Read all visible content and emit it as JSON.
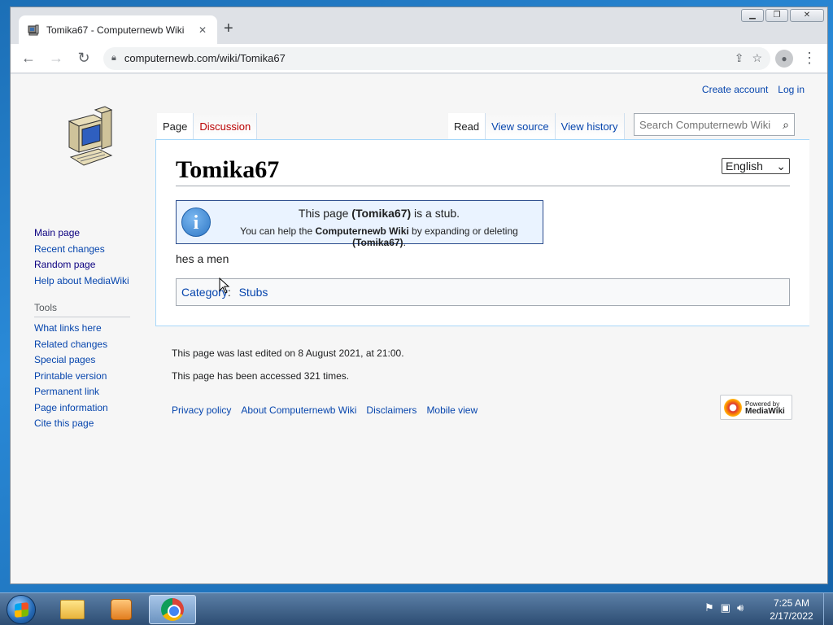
{
  "browser": {
    "tab_title": "Tomika67 - Computernewb Wiki",
    "tab_close": "✕",
    "new_tab": "+",
    "url": "computernewb.com/wiki/Tomika67",
    "window_controls": {
      "minimize": "▁",
      "maximize": "❐",
      "close": "✕"
    }
  },
  "wiki": {
    "personal": {
      "create_account": "Create account",
      "log_in": "Log in"
    },
    "namespace_tabs": [
      {
        "label": "Page"
      },
      {
        "label": "Discussion"
      }
    ],
    "view_tabs": [
      {
        "label": "Read"
      },
      {
        "label": "View source"
      },
      {
        "label": "View history"
      }
    ],
    "search_placeholder": "Search Computernewb Wiki",
    "navigation": [
      "Main page",
      "Recent changes",
      "Random page",
      "Help about MediaWiki"
    ],
    "tools_heading": "Tools",
    "tools": [
      "What links here",
      "Related changes",
      "Special pages",
      "Printable version",
      "Permanent link",
      "Page information",
      "Cite this page"
    ],
    "page_title": "Tomika67",
    "language_selected": "English",
    "stub": {
      "icon": "i",
      "line1_pre": "This page ",
      "line1_bold": "(Tomika67)",
      "line1_post": " is a stub.",
      "line2_pre": "You can help the ",
      "line2_bold1": "Computernewb Wiki",
      "line2_mid": " by expanding or deleting ",
      "line2_bold2": "(Tomika67)",
      "line2_post": "."
    },
    "body": "hes a men",
    "category_label": "Category",
    "category_colon": ":",
    "categories": [
      "Stubs"
    ],
    "footer": {
      "last_edited": "This page was last edited on 8 August 2021, at 21:00.",
      "accessed": "This page has been accessed 321 times.",
      "links": [
        "Privacy policy",
        "About Computernewb Wiki",
        "Disclaimers",
        "Mobile view"
      ],
      "powered_by": "Powered by",
      "mediawiki": "MediaWiki"
    }
  },
  "taskbar": {
    "time": "7:25 AM",
    "date": "2/17/2022"
  },
  "icons": {
    "back": "arrow-left-icon",
    "forward": "arrow-right-icon",
    "reload": "reload-icon",
    "lock": "lock-icon",
    "share": "share-icon",
    "bookmark": "star-icon",
    "profile": "profile-icon",
    "menu": "kebab-menu-icon",
    "search": "search-icon",
    "info": "info-icon"
  }
}
